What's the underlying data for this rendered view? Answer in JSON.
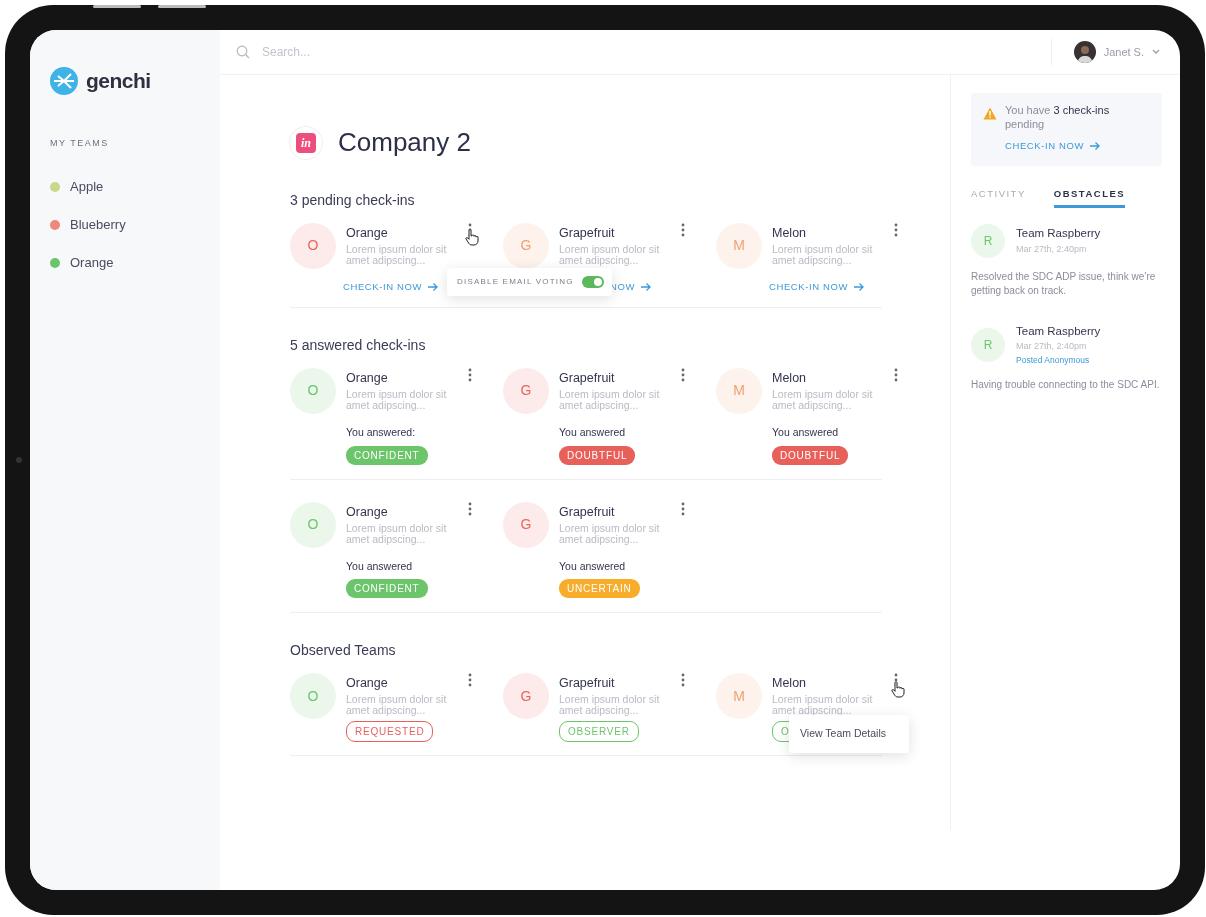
{
  "sidebar": {
    "logo": "genchi",
    "section_title": "MY TEAMS",
    "teams": [
      {
        "name": "Apple",
        "color": "#c6d98a"
      },
      {
        "name": "Blueberry",
        "color": "#f0867c"
      },
      {
        "name": "Orange",
        "color": "#6cc56a"
      }
    ]
  },
  "header": {
    "search": {
      "placeholder": "Search..."
    },
    "user": {
      "name": "Janet S."
    }
  },
  "company": {
    "logo_text": "in",
    "title": "Company 2"
  },
  "sections": [
    {
      "title": "3 pending check-ins",
      "rows": [
        [
          {
            "name": "Orange",
            "description": "Lorem ipsum dolor sit amet adipscing...",
            "avatar": {
              "letter": "O",
              "color": "#e8675c"
            },
            "footer": {
              "kind": "link",
              "text": "CHECK-IN NOW"
            },
            "menu": {
              "kind": "toggle",
              "label": "DISABLE EMAIL VOTING",
              "on": true
            }
          },
          {
            "name": "Grapefruit",
            "description": "Lorem ipsum dolor sit amet adipscing...",
            "avatar": {
              "letter": "G",
              "color": "#f0a070"
            },
            "footer": {
              "kind": "link",
              "text": "NOW"
            }
          },
          {
            "name": "Melon",
            "description": "Lorem ipsum dolor sit amet adipscing...",
            "avatar": {
              "letter": "M",
              "color": "#f0a070"
            },
            "footer": {
              "kind": "link",
              "text": "CHECK-IN NOW"
            }
          }
        ]
      ]
    },
    {
      "title": "5 answered check-ins",
      "rows": [
        [
          {
            "name": "Orange",
            "description": "Lorem ipsum dolor sit amet adipscing...",
            "avatar": {
              "letter": "O",
              "color": "#6cc56a"
            },
            "footer": {
              "kind": "answer",
              "label": "You answered:",
              "badge": {
                "text": "CONFIDENT",
                "kind": "confident"
              }
            }
          },
          {
            "name": "Grapefruit",
            "description": "Lorem ipsum dolor sit amet adipscing...",
            "avatar": {
              "letter": "G",
              "color": "#e8675c"
            },
            "footer": {
              "kind": "answer",
              "label": "You answered",
              "badge": {
                "text": "DOUBTFUL",
                "kind": "doubtful"
              }
            }
          },
          {
            "name": "Melon",
            "description": "Lorem ipsum dolor sit amet adipscing...",
            "avatar": {
              "letter": "M",
              "color": "#f0a070"
            },
            "footer": {
              "kind": "answer",
              "label": "You answered",
              "badge": {
                "text": "DOUBTFUL",
                "kind": "doubtful"
              }
            }
          }
        ],
        [
          {
            "name": "Orange",
            "description": "Lorem ipsum dolor sit amet adipscing...",
            "avatar": {
              "letter": "O",
              "color": "#6cc56a"
            },
            "footer": {
              "kind": "answer",
              "label": "You answered",
              "badge": {
                "text": "CONFIDENT",
                "kind": "confident"
              }
            }
          },
          {
            "name": "Grapefruit",
            "description": "Lorem ipsum dolor sit amet adipscing...",
            "avatar": {
              "letter": "G",
              "color": "#e8675c"
            },
            "footer": {
              "kind": "answer",
              "label": "You answered",
              "badge": {
                "text": "UNCERTAIN",
                "kind": "uncertain"
              }
            }
          }
        ]
      ]
    },
    {
      "title": "Observed Teams",
      "rows": [
        [
          {
            "name": "Orange",
            "description": "Lorem ipsum dolor sit amet adipscing...",
            "avatar": {
              "letter": "O",
              "color": "#6cc56a"
            },
            "footer": {
              "kind": "status",
              "badge": {
                "text": "REQUESTED",
                "kind": "requested"
              }
            }
          },
          {
            "name": "Grapefruit",
            "description": "Lorem ipsum dolor sit amet adipscing...",
            "avatar": {
              "letter": "G",
              "color": "#e8675c"
            },
            "footer": {
              "kind": "status",
              "badge": {
                "text": "OBSERVER",
                "kind": "observer"
              }
            }
          },
          {
            "name": "Melon",
            "description": "Lorem ipsum dolor sit amet adipscing...",
            "avatar": {
              "letter": "M",
              "color": "#f0a070"
            },
            "footer": {
              "kind": "status",
              "badge": {
                "text": "O",
                "kind": "observer"
              }
            },
            "menu": {
              "kind": "menu",
              "items": [
                "View Team Details"
              ]
            }
          }
        ]
      ]
    }
  ],
  "right_panel": {
    "alert": {
      "text": "You have **3 check-ins** pending",
      "link": "CHECK-IN NOW"
    },
    "tabs": [
      {
        "label": "ACTIVITY",
        "selected": false
      },
      {
        "label": "OBSTACLES",
        "selected": true
      }
    ],
    "feed": [
      {
        "team": "Team Raspberry",
        "date": "Mar 27th, 2:40pm",
        "avatar": {
          "letter": "R",
          "color": "#6cc56a"
        },
        "body": "Resolved the SDC ADP issue, think we’re getting back on track."
      },
      {
        "team": "Team Raspberry",
        "date": "Mar 27th, 2:40pm",
        "note": "Posted Anonymous",
        "avatar": {
          "letter": "R",
          "color": "#6cc56a"
        },
        "body": "Having trouble connecting to the SDC API."
      }
    ]
  }
}
